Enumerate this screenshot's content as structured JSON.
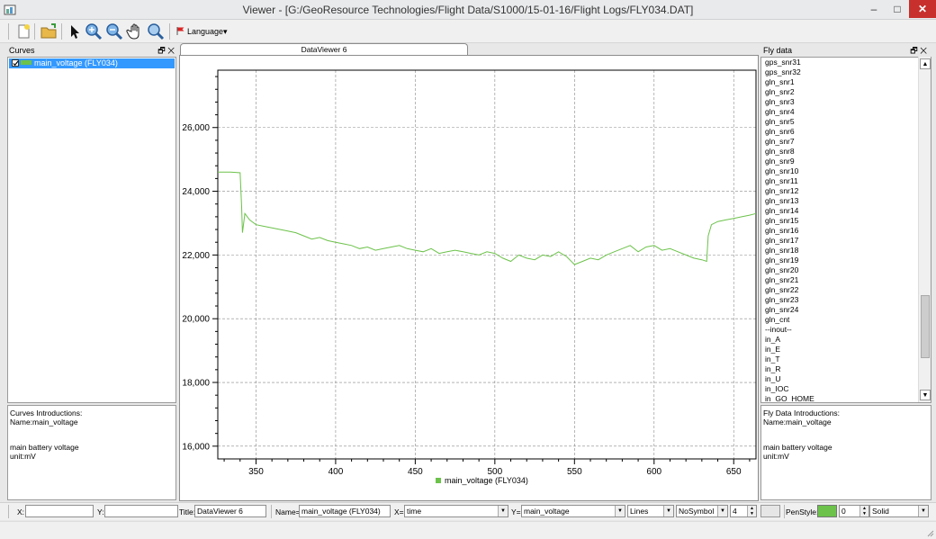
{
  "window": {
    "title": "Viewer - [G:/GeoResource Technologies/Flight Data/S1000/15-01-16/Flight Logs/FLY034.DAT]",
    "minimize": "–",
    "maximize": "□",
    "close": "✕"
  },
  "toolbar": {
    "language_label": "Language",
    "language_arrow": "▾"
  },
  "curves_panel": {
    "title": "Curves",
    "float_icon": "🗗",
    "close_icon": "✕",
    "items": [
      {
        "label": "main_voltage (FLY034)",
        "checked": true,
        "color": "#6cc24a"
      }
    ]
  },
  "curves_intro": {
    "heading": "Curves Introductions:",
    "name": "Name:main_voltage",
    "description": "main battery voltage",
    "unit": "unit:mV"
  },
  "tab": {
    "label": "DataViewer 6"
  },
  "chart_data": {
    "type": "line",
    "title": "",
    "xlabel": "",
    "ylabel": "",
    "xlim": [
      326,
      664
    ],
    "ylim": [
      15600,
      27800
    ],
    "x_ticks": [
      350,
      400,
      450,
      500,
      550,
      600,
      650
    ],
    "y_ticks": [
      16000,
      18000,
      20000,
      22000,
      24000,
      26000
    ],
    "y_tick_labels": [
      "16,000",
      "18,000",
      "20,000",
      "22,000",
      "24,000",
      "26,000"
    ],
    "grid": true,
    "legend": "bottom-center",
    "series": [
      {
        "name": "main_voltage (FLY034)",
        "color": "#6cc24a",
        "x": [
          326,
          334,
          340,
          341,
          341.5,
          343,
          346,
          350,
          355,
          360,
          365,
          370,
          375,
          380,
          385,
          390,
          395,
          400,
          405,
          410,
          415,
          420,
          425,
          430,
          435,
          440,
          445,
          450,
          455,
          460,
          465,
          470,
          475,
          480,
          485,
          490,
          495,
          500,
          505,
          510,
          515,
          520,
          525,
          530,
          535,
          540,
          545,
          550,
          555,
          560,
          565,
          570,
          575,
          580,
          585,
          590,
          595,
          600,
          605,
          610,
          615,
          620,
          625,
          630,
          633,
          634,
          636,
          640,
          645,
          650,
          655,
          660,
          664
        ],
        "y": [
          24600,
          24600,
          24580,
          23500,
          22700,
          23300,
          23100,
          22950,
          22900,
          22850,
          22800,
          22750,
          22700,
          22600,
          22500,
          22550,
          22450,
          22400,
          22350,
          22300,
          22200,
          22250,
          22150,
          22200,
          22250,
          22300,
          22200,
          22150,
          22100,
          22200,
          22050,
          22100,
          22150,
          22100,
          22050,
          22000,
          22100,
          22050,
          21900,
          21800,
          22000,
          21900,
          21850,
          22000,
          21950,
          22100,
          21950,
          21700,
          21800,
          21900,
          21850,
          22000,
          22100,
          22200,
          22300,
          22100,
          22250,
          22300,
          22150,
          22200,
          22100,
          22000,
          21900,
          21850,
          21800,
          22600,
          22950,
          23050,
          23100,
          23150,
          23200,
          23250,
          23300
        ]
      }
    ]
  },
  "fly_panel": {
    "title": "Fly data",
    "float_icon": "🗗",
    "close_icon": "✕",
    "items": [
      "gps_snr31",
      "gps_snr32",
      "gln_snr1",
      "gln_snr2",
      "gln_snr3",
      "gln_snr4",
      "gln_snr5",
      "gln_snr6",
      "gln_snr7",
      "gln_snr8",
      "gln_snr9",
      "gln_snr10",
      "gln_snr11",
      "gln_snr12",
      "gln_snr13",
      "gln_snr14",
      "gln_snr15",
      "gln_snr16",
      "gln_snr17",
      "gln_snr18",
      "gln_snr19",
      "gln_snr20",
      "gln_snr21",
      "gln_snr22",
      "gln_snr23",
      "gln_snr24",
      "gln_cnt",
      "    --inout--",
      "in_A",
      "in_E",
      "in_T",
      "in_R",
      "in_U",
      "in_IOC",
      "in_GO_HOME"
    ]
  },
  "fly_intro": {
    "heading": "Fly Data Introductions:",
    "name": "Name:main_voltage",
    "description": "main battery voltage",
    "unit": "unit:mV"
  },
  "bottom": {
    "x_label": "X:",
    "x_value": "",
    "y_label": "Y:",
    "y_value": "",
    "title_label": "Title:",
    "title_value": "DataViewer 6",
    "name_label": "Name=",
    "name_value": "main_voltage (FLY034)",
    "xaxis_label": "X=",
    "xaxis_value": "time",
    "yaxis_label": "Y=",
    "yaxis_value": "main_voltage",
    "style_value": "Lines",
    "symbol_value": "NoSymbol",
    "width_value": "4",
    "penstyle_label": "PenStyle:",
    "pen_color": "#6cc24a",
    "pen_width_value": "0",
    "pen_style_value": "Solid"
  }
}
